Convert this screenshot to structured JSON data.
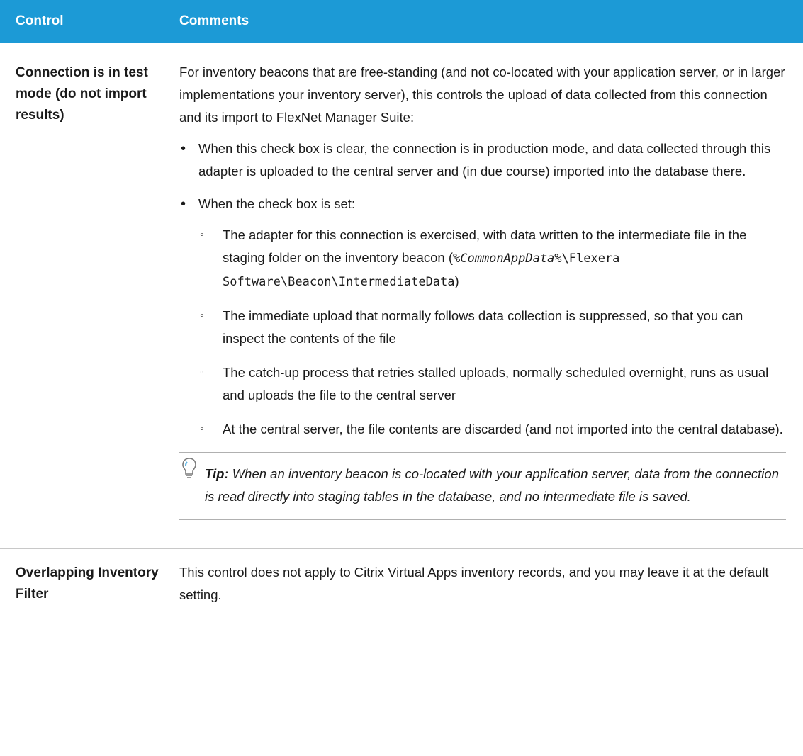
{
  "header": {
    "col1": "Control",
    "col2": "Comments"
  },
  "rows": [
    {
      "control": "Connection is in test mode (do not import results)",
      "intro": "For inventory beacons that are free-standing (and not co-located with your application server, or in larger implementations your inventory server), this controls the upload of data collected from this connection and its import to FlexNet Manager Suite:",
      "bullet1": "When this check box is clear, the connection is in production mode, and data collected through this adapter is uploaded to the central server and (in due course) imported into the database there.",
      "bullet2": "When the check box is set:",
      "sub1_text": "The adapter for this connection is exercised, with data written to the intermediate file in the staging folder on the inventory beacon (",
      "sub1_var": "%CommonAppData%",
      "sub1_path": "\\Flexera Software\\Beacon\\IntermediateData",
      "sub1_end": ")",
      "sub2": "The immediate upload that normally follows data collection is suppressed, so that you can inspect the contents of the file",
      "sub3": "The catch-up process that retries stalled uploads, normally scheduled overnight, runs as usual and uploads the file to the central server",
      "sub4": "At the central server, the file contents are discarded (and not imported into the central database).",
      "tip_label": "Tip:",
      "tip_text": " When an inventory beacon is co-located with your application server, data from the connection is read directly into staging tables in the database, and no intermediate file is saved."
    },
    {
      "control": "Overlapping Inventory Filter",
      "comment": "This control does not apply to Citrix Virtual Apps inventory records, and you may leave it at the default setting."
    }
  ],
  "colors": {
    "header_bg": "#1c9ad6",
    "header_text": "#ffffff"
  }
}
